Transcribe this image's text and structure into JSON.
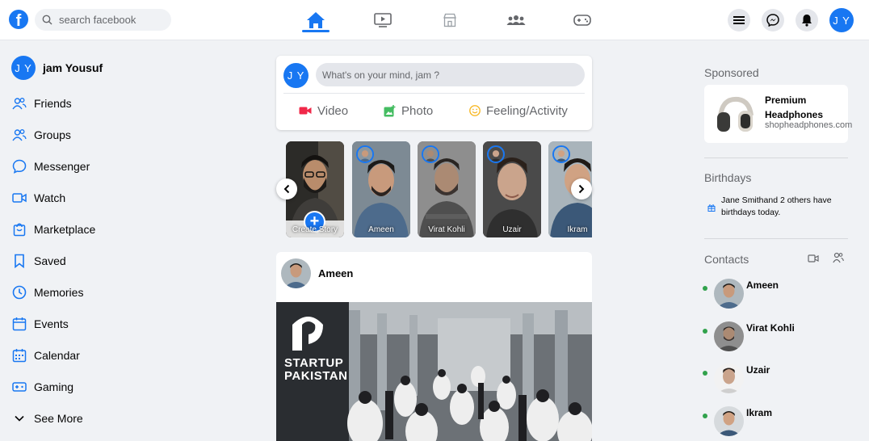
{
  "header": {
    "logo": "f",
    "search_placeholder": "search facebook",
    "nav": [
      "home-icon",
      "watch-icon",
      "marketplace-icon",
      "groups-icon",
      "gaming-icon"
    ],
    "user_initials": "J Y",
    "accent": "#1877f2"
  },
  "sidebar": {
    "profile": {
      "initials": "J Y",
      "name": "jam Yousuf"
    },
    "items": [
      {
        "label": "Friends",
        "icon": "friends-icon"
      },
      {
        "label": "Groups",
        "icon": "groups-icon"
      },
      {
        "label": "Messenger",
        "icon": "messenger-icon"
      },
      {
        "label": "Watch",
        "icon": "video-icon"
      },
      {
        "label": "Marketplace",
        "icon": "marketplace-icon"
      },
      {
        "label": "Saved",
        "icon": "bookmark-icon"
      },
      {
        "label": "Memories",
        "icon": "clock-icon"
      },
      {
        "label": "Events",
        "icon": "events-icon"
      },
      {
        "label": "Calendar",
        "icon": "calendar-icon"
      },
      {
        "label": "Gaming",
        "icon": "gaming-icon"
      },
      {
        "label": "See More",
        "icon": "chevron-down-icon"
      }
    ]
  },
  "composer": {
    "initials": "J Y",
    "placeholder": "What's on your mind, jam ?",
    "video": "Video",
    "photo": "Photo",
    "feeling": "Feeling/Activity"
  },
  "stories": [
    {
      "name": "Create Story"
    },
    {
      "name": "Ameen"
    },
    {
      "name": "Virat Kohli"
    },
    {
      "name": "Uzair"
    },
    {
      "name": "Ikram"
    }
  ],
  "post": {
    "author": "Ameen",
    "brand_line1": "STARTUP",
    "brand_line2": "PAKISTAN"
  },
  "right": {
    "sponsored_title": "Sponsored",
    "ad_title": "Premium Headphones",
    "ad_url": "shopheadphones.com",
    "birthdays_title": "Birthdays",
    "birthday_text": "Jane Smithand 2 others have birthdays today.",
    "contacts_title": "Contacts",
    "contacts": [
      "Ameen",
      "Virat Kohli",
      "Uzair",
      "Ikram"
    ]
  }
}
